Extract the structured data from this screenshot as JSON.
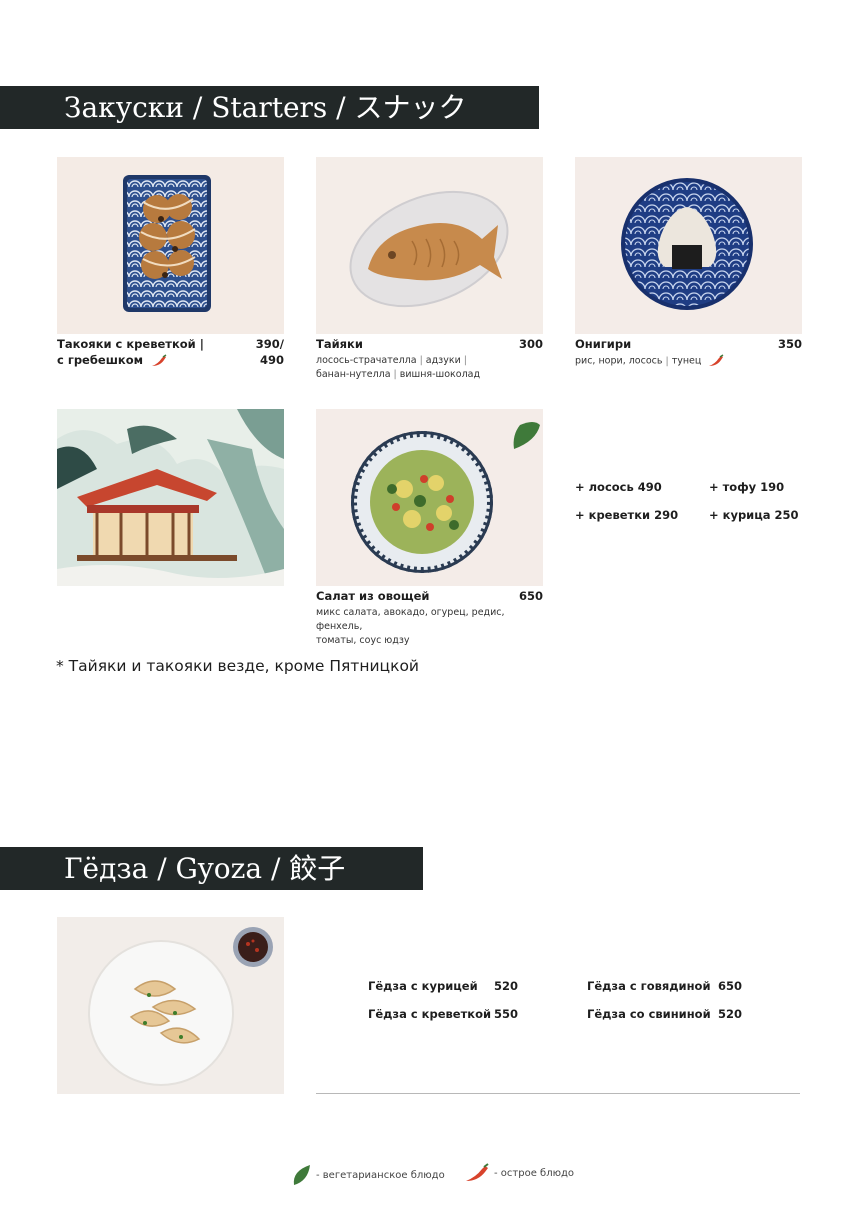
{
  "sections": {
    "starters_title": "Закуски / Starters / スナック",
    "gyoza_title": "Гёдза / Gyoza / 餃子"
  },
  "starters": [
    {
      "name_line1": "Такояки с креветкой  |",
      "name_line2": "с гребешком",
      "price_line1": "390/",
      "price_line2": "490",
      "spicy": true
    },
    {
      "name": "Тайяки",
      "price": "300",
      "desc_line1": [
        "лосось-страчателла",
        "адзуки"
      ],
      "desc_line2": [
        "банан-нутелла",
        "вишня-шоколад"
      ]
    },
    {
      "name": "Онигири",
      "price": "350",
      "desc": [
        "рис, нори, лосось",
        "тунец"
      ],
      "spicy": true
    },
    {
      "name": "Салат из овощей",
      "price": "650",
      "desc_line1": "микс салата, авокадо, огурец, редис, фенхель,",
      "desc_line2": "томаты, соус юдзу",
      "vegetarian": true
    }
  ],
  "addons": [
    {
      "label": "+ лосось 490"
    },
    {
      "label": "+ тофу 190"
    },
    {
      "label": "+ креветки 290"
    },
    {
      "label": "+ курица 250"
    }
  ],
  "note": "* Тайяки и такояки везде, кроме Пятницкой",
  "gyoza": [
    {
      "name": "Гёдза с курицей",
      "price": "520"
    },
    {
      "name": "Гёдза с креветкой",
      "price": "550"
    },
    {
      "name": "Гёдза с говядиной",
      "price": "650"
    },
    {
      "name": "Гёдза со свининой",
      "price": "520"
    }
  ],
  "legend": {
    "vegetarian": "- вегетарианское блюдо",
    "spicy": "- острое блюдо"
  },
  "colors": {
    "banner": "#222828",
    "leaf": "#3f7a3a",
    "pepper": "#d8432c",
    "photo_bg": "#f3ebe6"
  }
}
